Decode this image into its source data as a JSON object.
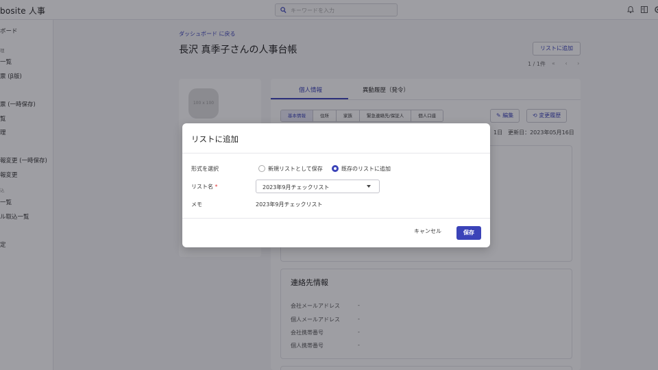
{
  "header": {
    "app_title": "bosite 人事",
    "search_placeholder": "キーワードを入力"
  },
  "sidebar": {
    "items": [
      "ボード",
      "理",
      "一覧",
      "票 (β版)",
      "票 (一時保存)",
      "覧",
      "理",
      "報変更 (一時保存)",
      "報変更",
      "込",
      "一覧",
      "ル取込一覧",
      "定"
    ]
  },
  "main": {
    "back_link": "ダッシュボード に戻る",
    "page_title": "長沢 真季子さんの人事台帳",
    "add_to_list_button": "リストに追加",
    "pager": "1 / 1件",
    "pager_nav": "« ‹ ›",
    "avatar_placeholder": "100 x 100",
    "tabs": [
      "個人情報",
      "異動履歴（発令）"
    ],
    "subtabs": [
      "基本情報",
      "住所",
      "家族",
      "緊急連絡先/保証人",
      "個人口座"
    ],
    "edit_button": "編集",
    "history_button": "変更履歴",
    "dates_text": "1日　更新日：2023年05月16日",
    "contact_section": {
      "title": "連絡先情報",
      "rows": [
        {
          "key": "会社メールアドレス",
          "value": "-"
        },
        {
          "key": "個人メールアドレス",
          "value": "-"
        },
        {
          "key": "会社携帯番号",
          "value": "-"
        },
        {
          "key": "個人携帯番号",
          "value": "-"
        }
      ]
    }
  },
  "modal": {
    "title": "リストに追加",
    "format_label": "形式を選択",
    "option_new": "新規リストとして保存",
    "option_existing": "既存のリストに追加",
    "selected_option": "existing",
    "list_name_label": "リスト名",
    "required_mark": "*",
    "list_name_value": "2023年9月チェックリスト",
    "memo_label": "メモ",
    "memo_value": "2023年9月チェックリスト",
    "cancel_label": "キャンセル",
    "save_label": "保存"
  },
  "colors": {
    "accent": "#3b43b8",
    "overlay": "rgba(25,25,35,0.42)"
  }
}
